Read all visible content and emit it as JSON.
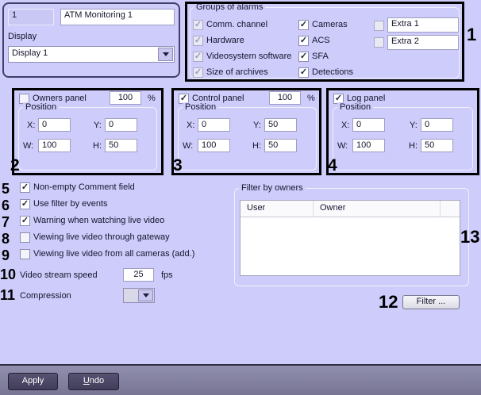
{
  "display_group": {
    "id_value": "1",
    "name_value": "ATM Monitoring 1",
    "display_label": "Display",
    "display_value": "Display 1"
  },
  "groups_of_alarms": {
    "annotation": "1",
    "title": "Groups of alarms",
    "col1": [
      {
        "label": "Comm. channel",
        "checked": true
      },
      {
        "label": "Hardware",
        "checked": true
      },
      {
        "label": "Videosystem software",
        "checked": true
      },
      {
        "label": "Size of archives",
        "checked": true
      }
    ],
    "col2": [
      {
        "label": "Cameras",
        "checked": true
      },
      {
        "label": "ACS",
        "checked": true
      },
      {
        "label": "SFA",
        "checked": true
      },
      {
        "label": "Detections",
        "checked": true
      }
    ],
    "extras": [
      {
        "value": "Extra 1",
        "checked": false
      },
      {
        "value": "Extra 2",
        "checked": false
      }
    ]
  },
  "panels": [
    {
      "annotation": "2",
      "title": "Owners panel",
      "checked": false,
      "percent": "100",
      "percent_unit": "%",
      "position_title": "Position",
      "fields": {
        "x_label": "X:",
        "x": "0",
        "y_label": "Y:",
        "y": "0",
        "w_label": "W:",
        "w": "100",
        "h_label": "H:",
        "h": "50"
      }
    },
    {
      "annotation": "3",
      "title": "Control panel",
      "checked": true,
      "percent": "100",
      "percent_unit": "%",
      "position_title": "Position",
      "fields": {
        "x_label": "X:",
        "x": "0",
        "y_label": "Y:",
        "y": "50",
        "w_label": "W:",
        "w": "100",
        "h_label": "H:",
        "h": "50"
      }
    },
    {
      "annotation": "4",
      "title": "Log panel",
      "checked": true,
      "position_title": "Position",
      "fields": {
        "x_label": "X:",
        "x": "0",
        "y_label": "Y:",
        "y": "0",
        "w_label": "W:",
        "w": "100",
        "h_label": "H:",
        "h": "50"
      }
    }
  ],
  "options": [
    {
      "num": "5",
      "label": "Non-empty Comment field",
      "checked": true
    },
    {
      "num": "6",
      "label": "Use filter by events",
      "checked": true
    },
    {
      "num": "7",
      "label": "Warning when watching live video",
      "checked": true
    },
    {
      "num": "8",
      "label": "Viewing live video through gateway",
      "checked": false
    },
    {
      "num": "9",
      "label": "Viewing live video from all cameras (add.)",
      "checked": false
    }
  ],
  "video_stream": {
    "num": "10",
    "label": "Video stream speed",
    "value": "25",
    "unit": "fps"
  },
  "compression": {
    "num": "11",
    "label": "Compression"
  },
  "filter_group": {
    "annotation": "13",
    "title": "Filter by owners",
    "columns": [
      "User",
      "Owner"
    ],
    "rows": []
  },
  "filter_button": {
    "num": "12",
    "label": "Filter ..."
  },
  "footer": {
    "apply_label": "Apply",
    "undo_accel": "U",
    "undo_rest": "ndo"
  }
}
